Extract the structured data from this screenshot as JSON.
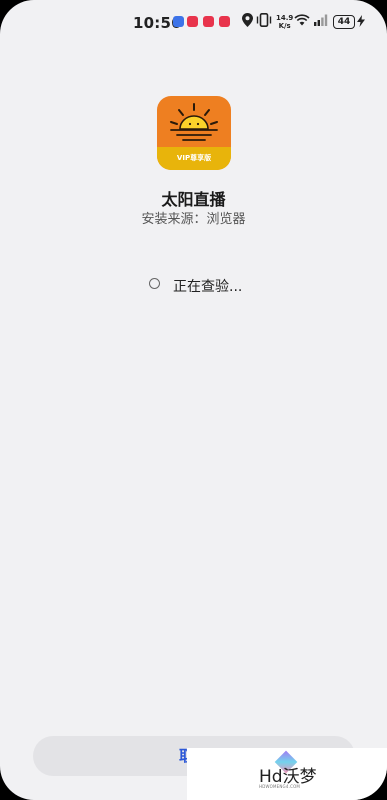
{
  "status_bar": {
    "time": "10:56",
    "net_speed_value": "14.9",
    "net_speed_unit": "K/s",
    "battery": "44",
    "icons": [
      "notification-blue-icon",
      "notification-red-icon",
      "notification-red-icon",
      "notification-red-icon",
      "location-icon",
      "vibrate-icon",
      "wifi-icon",
      "signal-icon",
      "battery-icon",
      "charging-bolt-icon"
    ]
  },
  "app": {
    "icon_badge": "VIP尊享版",
    "name": "太阳直播",
    "install_source": "安装来源：浏览器"
  },
  "progress": {
    "status_text": "正在查验..."
  },
  "actions": {
    "cancel_label": "取消"
  },
  "watermark": {
    "text": "Hd沃梦",
    "subtext": "HDWOMENG4.COM"
  },
  "colors": {
    "background": "#f1f1f3",
    "accent": "#2c58d8",
    "app_icon_orange": "#ee7f21",
    "app_icon_gold": "#e8b40b"
  }
}
